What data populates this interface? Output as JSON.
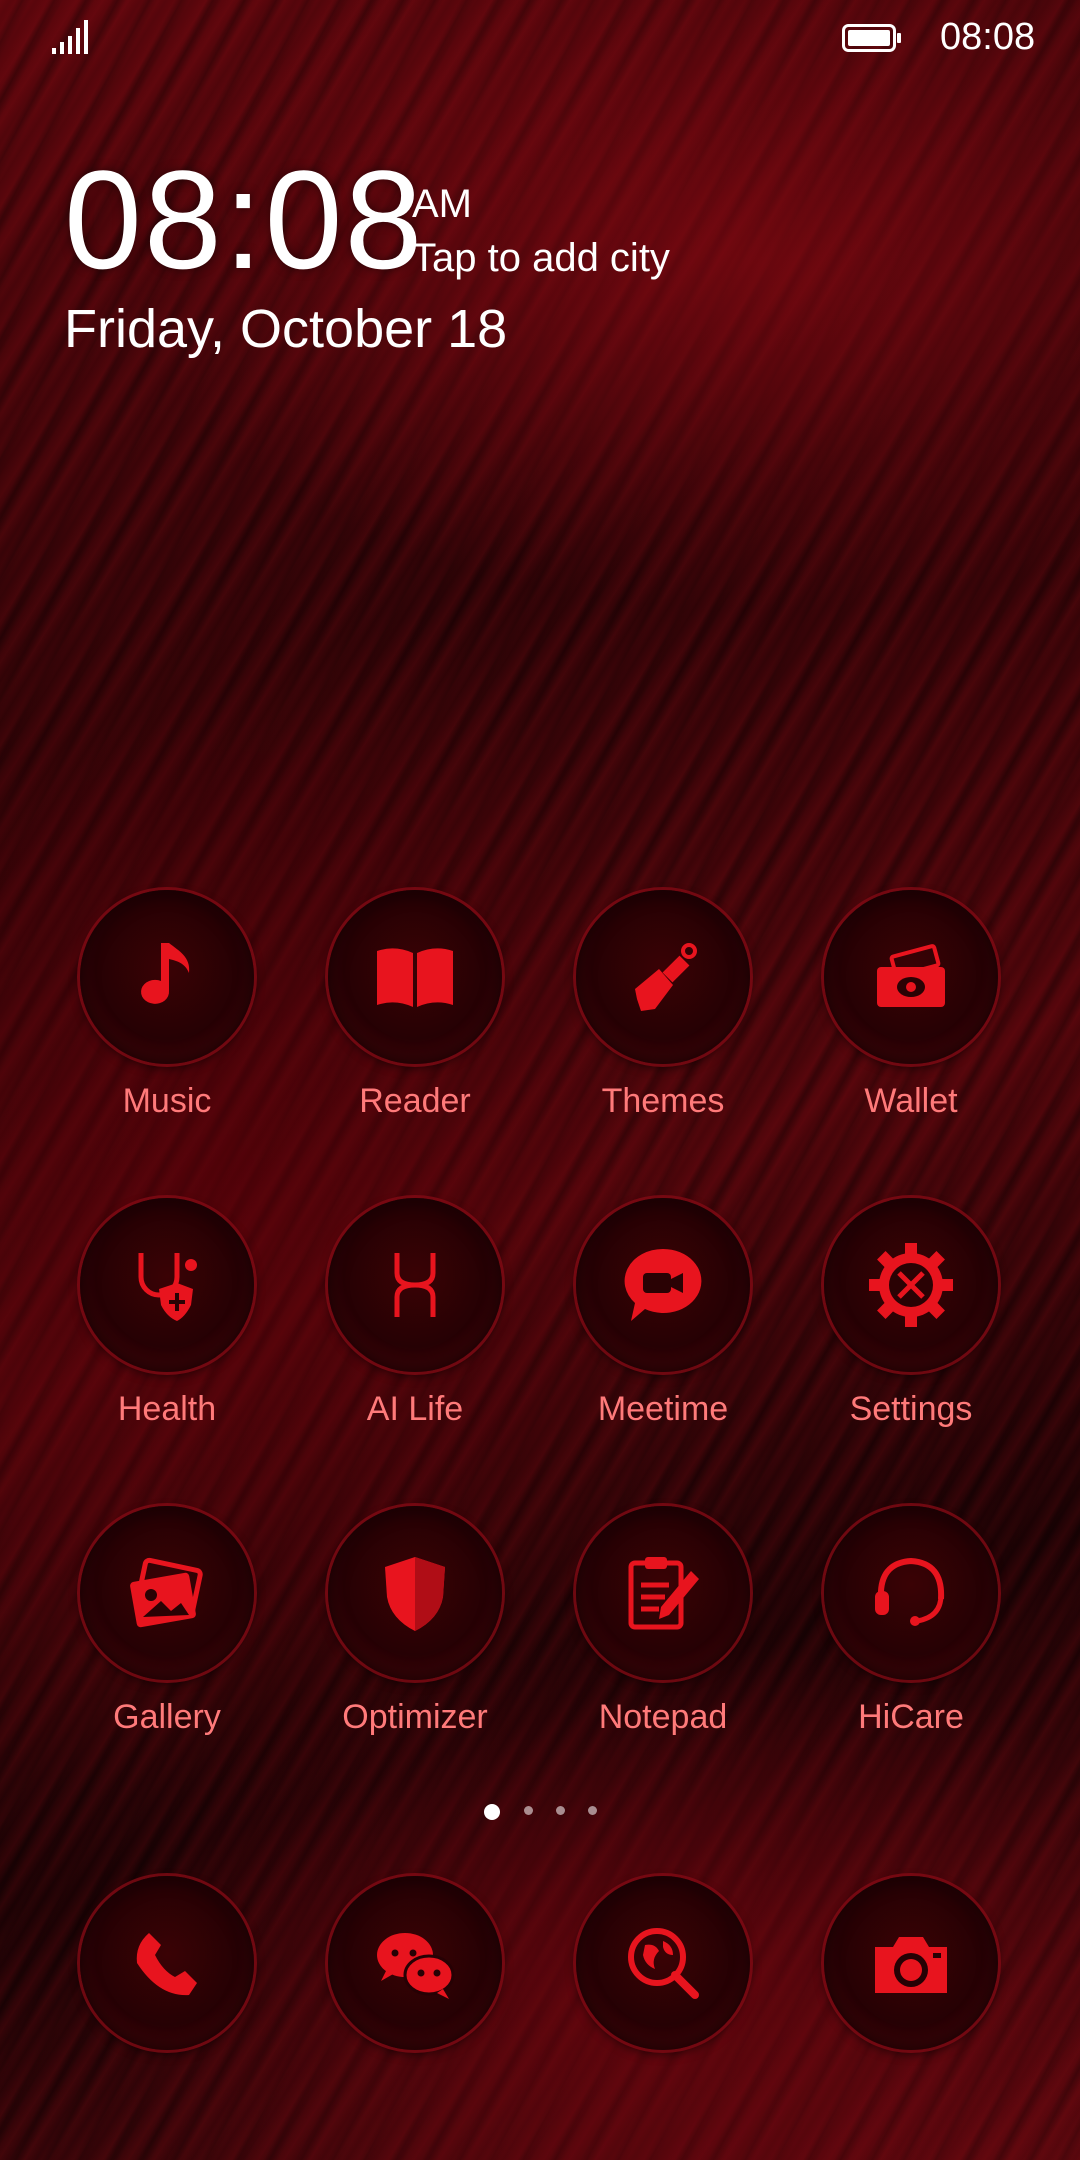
{
  "status_bar": {
    "time": "08:08",
    "signal_icon": "signal-icon",
    "battery_icon": "battery-icon"
  },
  "lock_widget": {
    "time": "08:08",
    "ampm": "AM",
    "city_prompt": "Tap to add city",
    "date": "Friday, October 18"
  },
  "apps": [
    {
      "label": "Music",
      "icon": "music-note-icon"
    },
    {
      "label": "Reader",
      "icon": "book-icon"
    },
    {
      "label": "Themes",
      "icon": "paintbrush-icon"
    },
    {
      "label": "Wallet",
      "icon": "wallet-icon"
    },
    {
      "label": "Health",
      "icon": "stethoscope-icon"
    },
    {
      "label": "AI Life",
      "icon": "ai-life-icon"
    },
    {
      "label": "Meetime",
      "icon": "video-chat-icon"
    },
    {
      "label": "Settings",
      "icon": "gear-icon"
    },
    {
      "label": "Gallery",
      "icon": "gallery-icon"
    },
    {
      "label": "Optimizer",
      "icon": "shield-icon"
    },
    {
      "label": "Notepad",
      "icon": "notepad-icon"
    },
    {
      "label": "HiCare",
      "icon": "headset-icon"
    }
  ],
  "page_indicator": {
    "pages": 4,
    "current": 1
  },
  "dock": [
    {
      "icon": "phone-icon"
    },
    {
      "icon": "chat-icon"
    },
    {
      "icon": "browser-icon"
    },
    {
      "icon": "camera-icon"
    }
  ],
  "colors": {
    "icon_red": "#e8141e",
    "label_red": "#ff7a7a"
  }
}
